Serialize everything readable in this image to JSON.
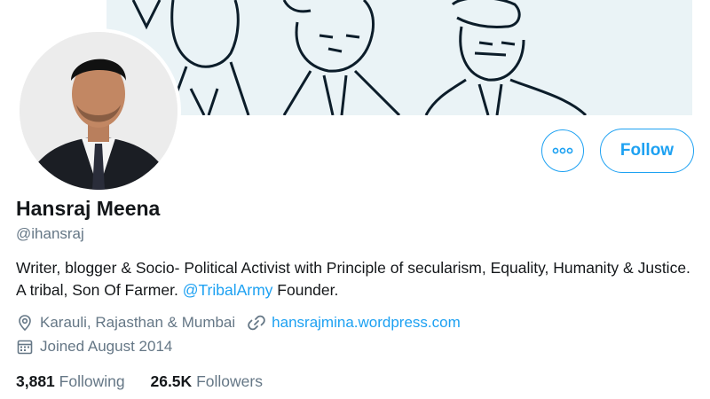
{
  "profile": {
    "name": "Hansraj Meena",
    "handle": "@ihansraj",
    "bio_text": "Writer, blogger & Socio- Political Activist with Principle of secularism, Equality, Humanity & Justice. A tribal, Son Of Farmer. ",
    "bio_mention": "@TribalArmy",
    "bio_suffix": " Founder.",
    "location": "Karauli, Rajasthan & Mumbai",
    "website": "hansrajmina.wordpress.com",
    "joined": "Joined August 2014"
  },
  "actions": {
    "more_icon": "more-options-icon",
    "follow_label": "Follow"
  },
  "stats": {
    "following_count": "3,881",
    "following_label": "Following",
    "followers_count": "26.5K",
    "followers_label": "Followers"
  },
  "icons": {
    "location": "location-pin-icon",
    "link": "link-icon",
    "calendar": "calendar-icon"
  },
  "colors": {
    "accent": "#1da1f2",
    "secondary_text": "#657786",
    "primary_text": "#14171a",
    "banner_bg": "#eaf3f6"
  }
}
